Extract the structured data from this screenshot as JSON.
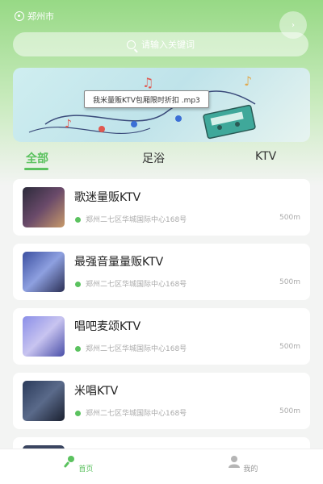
{
  "header": {
    "location": "郑州市",
    "search_placeholder": "请输入关键词"
  },
  "banner": {
    "label": "我米量贩KTV包厢限时折扣  .mp3"
  },
  "tabs": [
    "全部",
    "足浴",
    "KTV"
  ],
  "active_tab": 0,
  "venues": [
    {
      "name": "歌迷量贩KTV",
      "address": "郑州二七区华城国际中心168号",
      "distance": "500m"
    },
    {
      "name": "最强音量量贩KTV",
      "address": "郑州二七区华城国际中心168号",
      "distance": "500m"
    },
    {
      "name": "唱吧麦颂KTV",
      "address": "郑州二七区华城国际中心168号",
      "distance": "500m"
    },
    {
      "name": "米唱KTV",
      "address": "郑州二七区华城国际中心168号",
      "distance": "500m"
    }
  ],
  "bottom_nav": [
    {
      "label": "首页",
      "icon": "microphone-icon"
    },
    {
      "label": "我的",
      "icon": "user-icon"
    }
  ],
  "colors": {
    "accent": "#5bc25f",
    "header_top": "#97d985"
  }
}
